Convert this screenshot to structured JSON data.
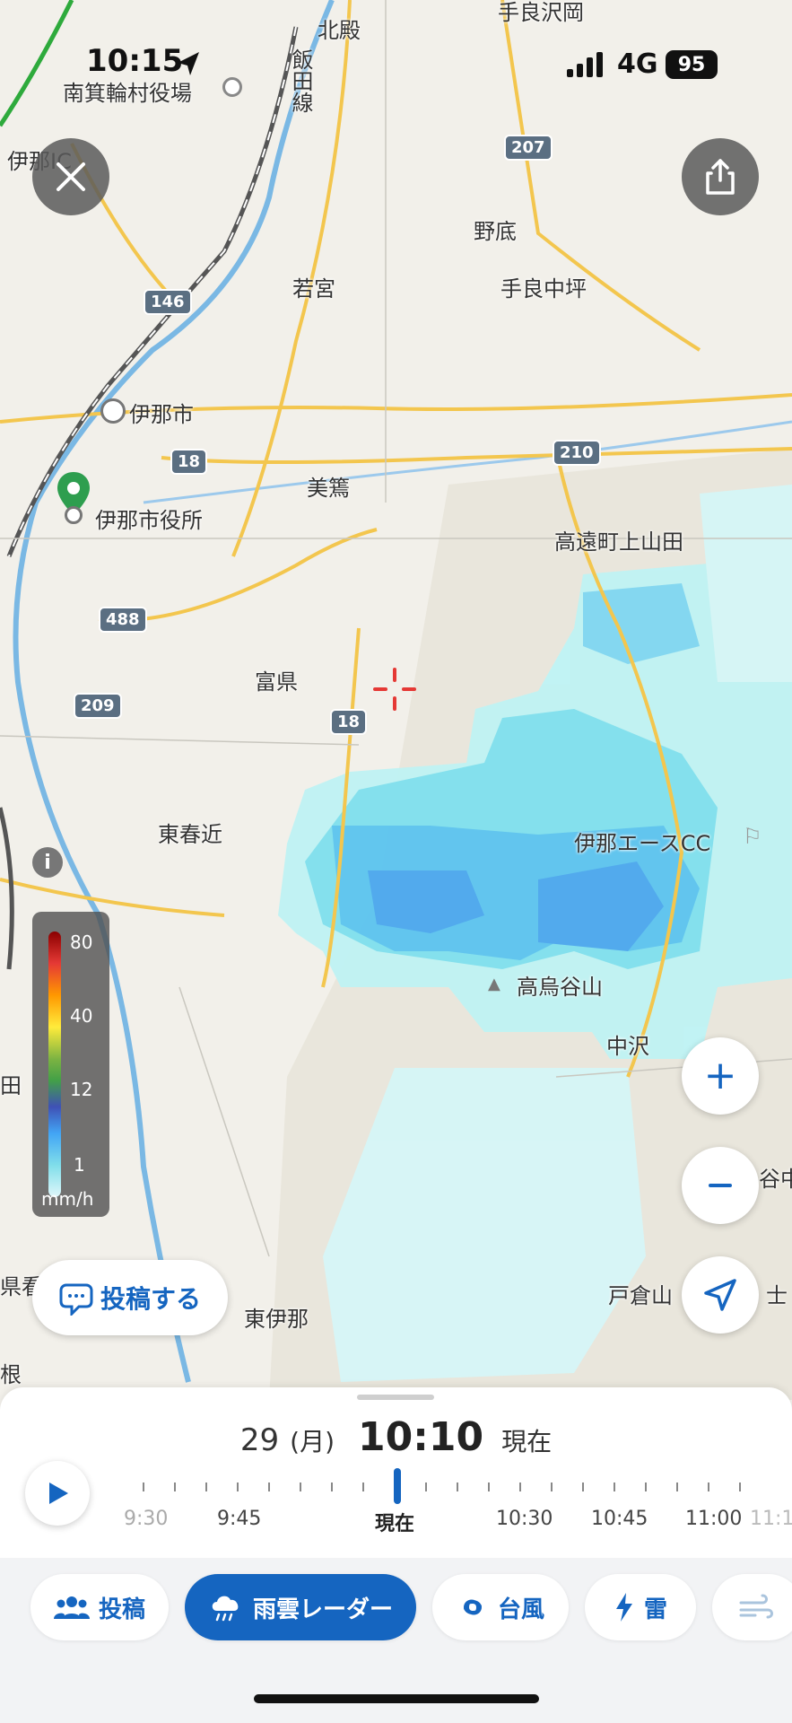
{
  "status_bar": {
    "time": "10:15",
    "network": "4G",
    "battery": "95"
  },
  "map_labels": [
    "手良沢岡",
    "北殿",
    "南箕輪村役場",
    "伊那IC",
    "飯田線",
    "207",
    "野底",
    "若宮",
    "手良中坪",
    "146",
    "伊那市",
    "18",
    "210",
    "美篶",
    "伊那市役所",
    "高遠町上山田",
    "488",
    "富県",
    "209",
    "東春近",
    "伊那エースCC",
    "高烏谷山",
    "中沢",
    "田",
    "東伊那",
    "戸倉山",
    "谷中",
    "県看",
    "根",
    "士"
  ],
  "legend": {
    "ticks": [
      "80",
      "40",
      "12",
      "1"
    ],
    "unit": "mm/h"
  },
  "post_button": {
    "label": "投稿する"
  },
  "time_panel": {
    "date": "29",
    "weekday": "(月)",
    "time": "10:10",
    "status": "現在",
    "timeline_labels": [
      "9:30",
      "9:45",
      "現在",
      "10:30",
      "10:45",
      "11:00",
      "11:1"
    ]
  },
  "tabs": [
    {
      "label": "投稿"
    },
    {
      "label": "雨雲レーダー"
    },
    {
      "label": "台風"
    },
    {
      "label": "雷"
    }
  ],
  "colors": {
    "accent": "#1565c0",
    "crosshair": "#e53935",
    "pin": "#2e9e4f"
  }
}
